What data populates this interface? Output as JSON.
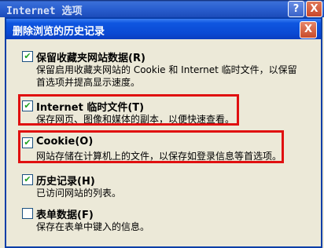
{
  "outer_window": {
    "title": "Internet 选项",
    "help_label": "?",
    "close_label": "X"
  },
  "dialog": {
    "title": "删除浏览的历史记录",
    "close_label": "X"
  },
  "options": [
    {
      "label": "保留收藏夹网站数据(R)",
      "desc_lines": [
        "保留启用收藏夹网站的 Cookie 和 Internet 临时文件，以保留",
        "首选项并提高显示速度。"
      ],
      "checked": true
    },
    {
      "label": "Internet 临时文件(T)",
      "desc_lines": [
        "保存网页、图像和媒体的副本，以便快速查看。"
      ],
      "checked": true
    },
    {
      "label": "Cookie(O)",
      "desc_lines": [
        "网站存储在计算机上的文件，以保存如登录信息等首选项。"
      ],
      "checked": true
    },
    {
      "label": "历史记录(H)",
      "desc_lines": [
        "已访问网站的列表。"
      ],
      "checked": true
    },
    {
      "label": "表单数据(F)",
      "desc_lines": [
        "保存在表单中键入的信息。"
      ],
      "checked": false
    }
  ],
  "colors": {
    "highlight": "#e01010",
    "titlebar": "#0a4ad4",
    "checkmark": "#21a121"
  }
}
